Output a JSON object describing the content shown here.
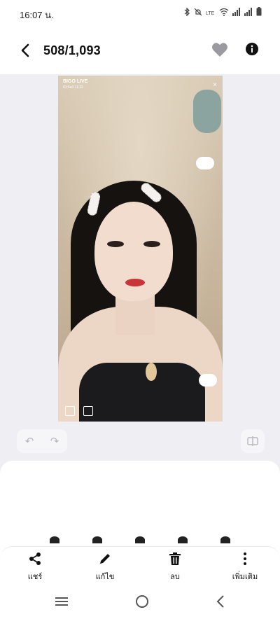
{
  "status_bar": {
    "time": "16:07 น.",
    "icons": [
      "bluetooth-icon",
      "mute-icon",
      "volte-icon",
      "wifi-icon",
      "signal-icon",
      "signal-icon",
      "battery-icon"
    ]
  },
  "header": {
    "title": "508/1,093",
    "back_icon": "chevron-left-icon",
    "favorite_icon": "heart-icon",
    "info_icon": "info-icon"
  },
  "photo": {
    "watermark": "BIGO LIVE",
    "watermark_sub": "ID:Sa3 11:33",
    "close_glyph": "×"
  },
  "edit_row": {
    "undo_glyph": "↶",
    "redo_glyph": "↷"
  },
  "actions": [
    {
      "label": "แชร์",
      "icon": "share-icon"
    },
    {
      "label": "แก้ไข",
      "icon": "edit-pencil-icon"
    },
    {
      "label": "ลบ",
      "icon": "trash-icon"
    },
    {
      "label": "เพิ่มเติม",
      "icon": "more-vertical-icon"
    }
  ],
  "colors": {
    "background": "#efeef3",
    "surface": "#ffffff",
    "text": "#111111"
  }
}
